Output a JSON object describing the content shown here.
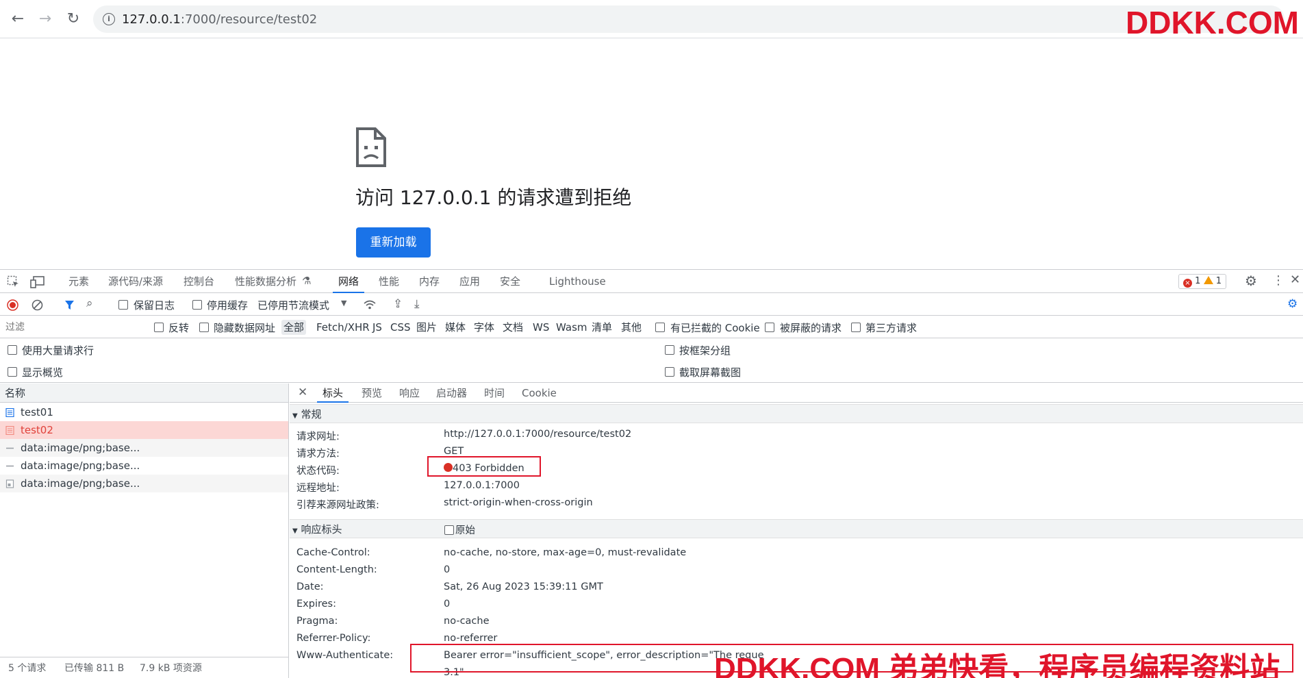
{
  "browser": {
    "url_host": "127.0.0.1",
    "url_rest": ":7000/resource/test02",
    "watermark": "DDKK.COM",
    "colors": {
      "accent": "#1a73e8",
      "error": "#d93025",
      "watermark": "#e0152a"
    }
  },
  "error_page": {
    "title": "访问 127.0.0.1 的请求遭到拒绝",
    "reload_label": "重新加载"
  },
  "devtools": {
    "tabs": [
      "元素",
      "源代码/来源",
      "控制台",
      "性能数据分析",
      "网络",
      "性能",
      "内存",
      "应用",
      "安全",
      "Lighthouse"
    ],
    "active_tab": "网络",
    "error_count": "1",
    "warning_count": "1",
    "toolbar": {
      "preserve_log": "保留日志",
      "disable_cache": "停用缓存",
      "throttle": "已停用节流模式"
    },
    "filter": {
      "placeholder": "过滤",
      "invert": "反转",
      "hide_data_urls": "隐藏数据网址",
      "types": [
        "全部",
        "Fetch/XHR",
        "JS",
        "CSS",
        "图片",
        "媒体",
        "字体",
        "文档",
        "WS",
        "Wasm",
        "清单",
        "其他"
      ],
      "blocked_cookies": "有已拦截的 Cookie",
      "blocked_requests": "被屏蔽的请求",
      "third_party": "第三方请求"
    },
    "options": {
      "large_rows": "使用大量请求行",
      "show_overview": "显示概览",
      "group_by_frame": "按框架分组",
      "capture_screenshots": "截取屏幕截图"
    },
    "requests": {
      "header": "名称",
      "rows": [
        "test01",
        "test02",
        "data:image/png;base...",
        "data:image/png;base...",
        "data:image/png;base..."
      ],
      "footer": {
        "count": "5 个请求",
        "transferred": "已传输 811 B",
        "resources": "7.9 kB 项资源"
      }
    },
    "detail": {
      "tabs": [
        "标头",
        "预览",
        "响应",
        "启动器",
        "时间",
        "Cookie"
      ],
      "active_tab": "标头",
      "general_title": "常规",
      "general": [
        {
          "key": "请求网址:",
          "value": "http://127.0.0.1:7000/resource/test02"
        },
        {
          "key": "请求方法:",
          "value": "GET"
        },
        {
          "key": "状态代码:",
          "value": "403 Forbidden"
        },
        {
          "key": "远程地址:",
          "value": "127.0.0.1:7000"
        },
        {
          "key": "引荐来源网址政策:",
          "value": "strict-origin-when-cross-origin"
        }
      ],
      "response_title": "响应标头",
      "raw_label": "原始",
      "response": [
        {
          "key": "Cache-Control:",
          "value": "no-cache, no-store, max-age=0, must-revalidate"
        },
        {
          "key": "Content-Length:",
          "value": "0"
        },
        {
          "key": "Date:",
          "value": "Sat, 26 Aug 2023 15:39:11 GMT"
        },
        {
          "key": "Expires:",
          "value": "0"
        },
        {
          "key": "Pragma:",
          "value": "no-cache"
        },
        {
          "key": "Referrer-Policy:",
          "value": "no-referrer"
        },
        {
          "key": "Www-Authenticate:",
          "value": "Bearer error=\"insufficient_scope\", error_description=\"The reque"
        },
        {
          "key": "",
          "value": "3.1\""
        }
      ]
    }
  },
  "watermark_bottom": "DDKK.COM 弟弟快看，程序员编程资料站"
}
